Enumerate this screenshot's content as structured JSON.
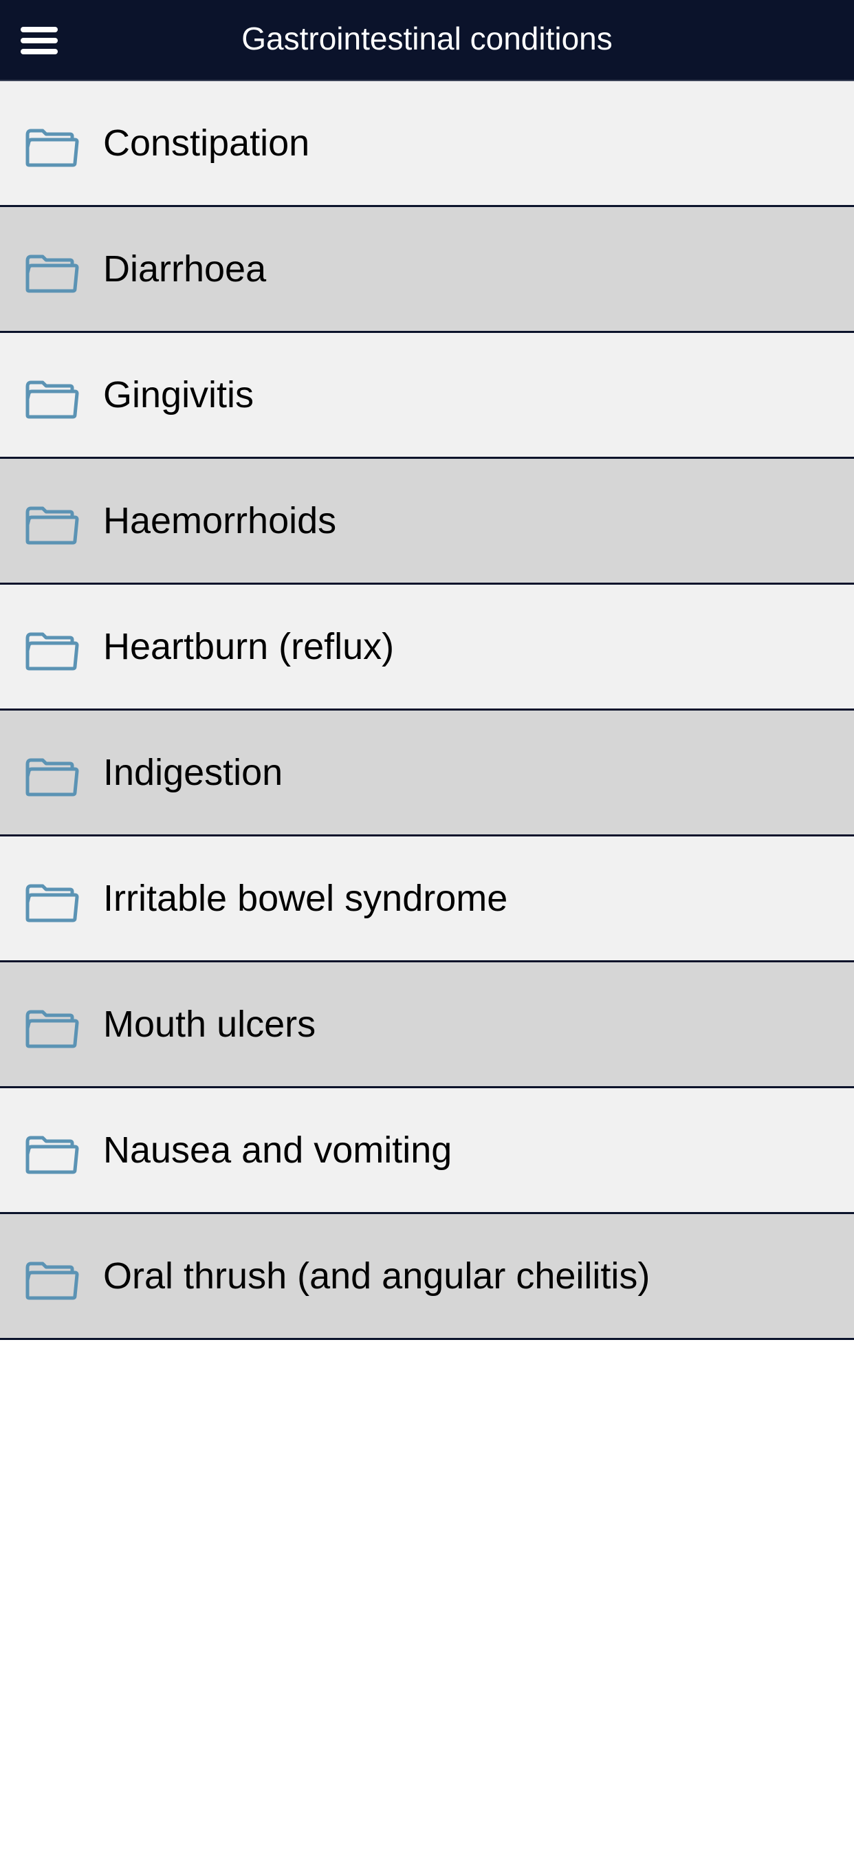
{
  "header": {
    "title": "Gastrointestinal conditions",
    "menu_icon": "hamburger-menu-icon",
    "background_color": "#0b132b",
    "title_color": "#ffffff"
  },
  "list": {
    "item_icon": "folder-icon",
    "icon_color": "#5b93b4",
    "row_colors": [
      "#f1f1f1",
      "#d6d6d6"
    ],
    "items": [
      {
        "label": "Constipation"
      },
      {
        "label": "Diarrhoea"
      },
      {
        "label": "Gingivitis"
      },
      {
        "label": "Haemorrhoids"
      },
      {
        "label": "Heartburn (reflux)"
      },
      {
        "label": "Indigestion"
      },
      {
        "label": "Irritable bowel syndrome"
      },
      {
        "label": "Mouth ulcers"
      },
      {
        "label": "Nausea and vomiting"
      },
      {
        "label": "Oral thrush (and angular cheilitis)"
      }
    ]
  }
}
